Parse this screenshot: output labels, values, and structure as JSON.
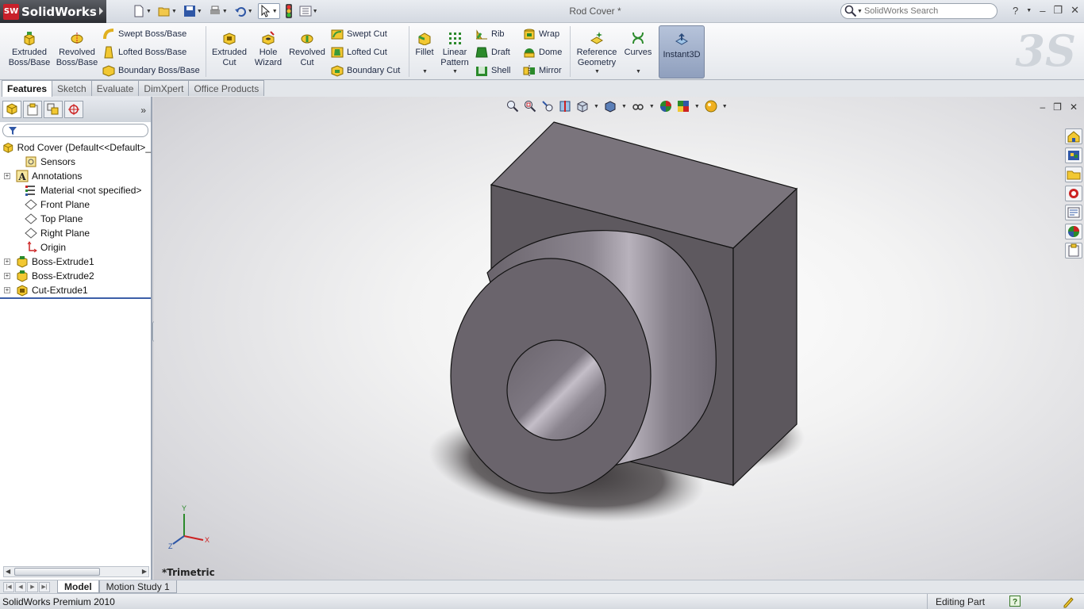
{
  "app": {
    "name": "SolidWorks",
    "logo_text": "SW"
  },
  "window": {
    "title": "Rod Cover *"
  },
  "search": {
    "placeholder": "SolidWorks Search"
  },
  "window_controls": {
    "help": "?",
    "minimize": "–",
    "restore": "❐",
    "close": "✕"
  },
  "ribbon": {
    "extruded_boss": "Extruded Boss/Base",
    "revolved_boss": "Revolved Boss/Base",
    "swept_boss": "Swept Boss/Base",
    "lofted_boss": "Lofted Boss/Base",
    "boundary_boss": "Boundary Boss/Base",
    "extruded_cut": "Extruded Cut",
    "hole_wizard": "Hole Wizard",
    "revolved_cut": "Revolved Cut",
    "swept_cut": "Swept Cut",
    "lofted_cut": "Lofted Cut",
    "boundary_cut": "Boundary Cut",
    "fillet": "Fillet",
    "linear_pattern": "Linear Pattern",
    "rib": "Rib",
    "draft": "Draft",
    "shell": "Shell",
    "wrap": "Wrap",
    "dome": "Dome",
    "mirror": "Mirror",
    "reference_geometry": "Reference Geometry",
    "curves": "Curves",
    "instant3d": "Instant3D"
  },
  "cm_tabs": [
    "Features",
    "Sketch",
    "Evaluate",
    "DimXpert",
    "Office Products"
  ],
  "tree": {
    "root": "Rod Cover  (Default<<Default>_",
    "items": [
      {
        "label": "Sensors",
        "expandable": false
      },
      {
        "label": "Annotations",
        "expandable": true
      },
      {
        "label": "Material <not specified>",
        "expandable": false
      },
      {
        "label": "Front Plane",
        "expandable": false
      },
      {
        "label": "Top Plane",
        "expandable": false
      },
      {
        "label": "Right Plane",
        "expandable": false
      },
      {
        "label": "Origin",
        "expandable": false
      },
      {
        "label": "Boss-Extrude1",
        "expandable": true
      },
      {
        "label": "Boss-Extrude2",
        "expandable": true
      },
      {
        "label": "Cut-Extrude1",
        "expandable": true
      }
    ]
  },
  "viewport": {
    "view_name": "*Trimetric",
    "axis_x": "X",
    "axis_y": "Y",
    "axis_z": "Z"
  },
  "bottom_tabs": [
    "Model",
    "Motion Study 1"
  ],
  "status": {
    "product": "SolidWorks Premium 2010",
    "mode": "Editing Part"
  },
  "colors": {
    "accent": "#3c5fa8",
    "part_face": "#78727a",
    "background_top": "#ffffff"
  }
}
